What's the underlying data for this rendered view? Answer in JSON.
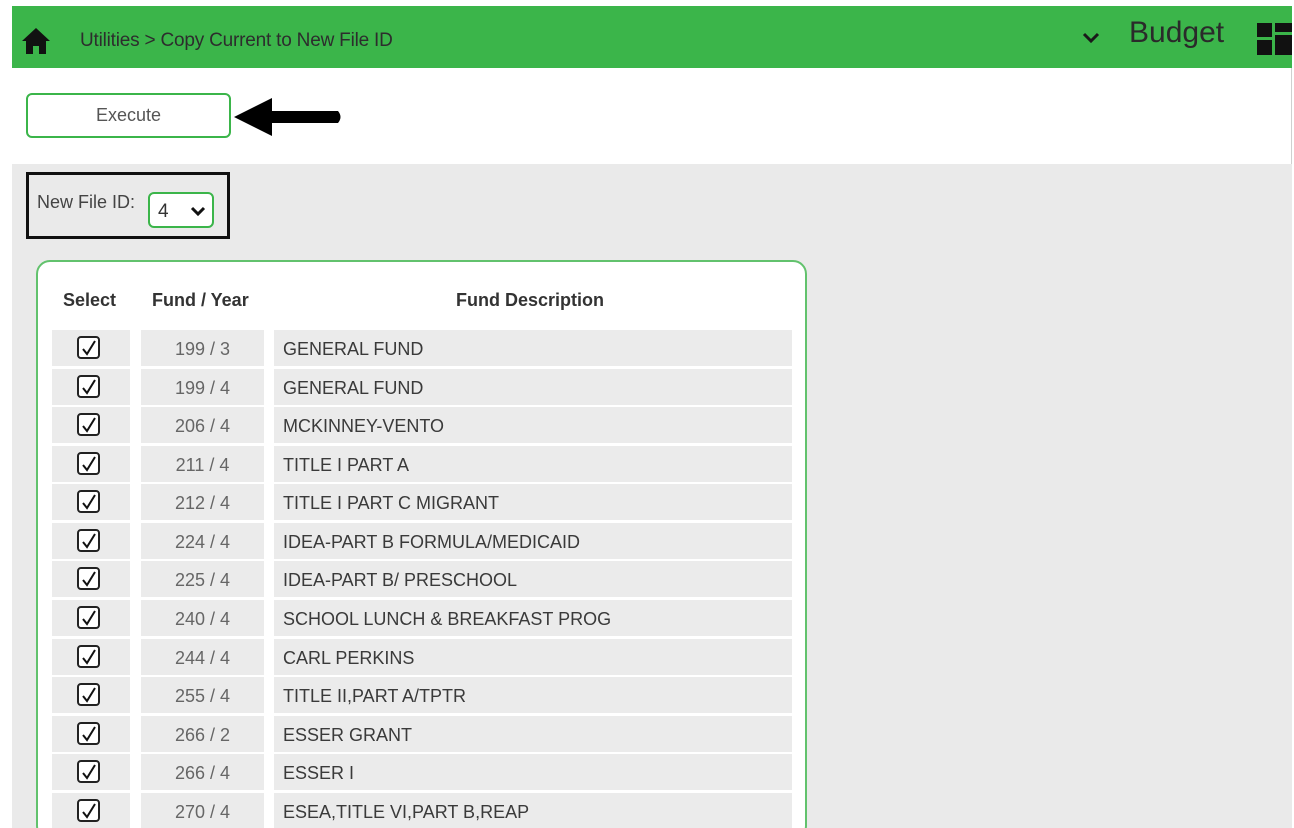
{
  "header": {
    "breadcrumb": "Utilities > Copy Current to New File ID",
    "app_title": "Budget",
    "icons": {
      "home": "home-icon",
      "menu": "chevron-down-icon",
      "layout": "grid-layout-icon"
    },
    "color": "#3bb54a"
  },
  "toolbar": {
    "execute_label": "Execute"
  },
  "file_id": {
    "label": "New File ID:",
    "value": "4"
  },
  "table": {
    "headers": {
      "select": "Select",
      "fund_year": "Fund / Year",
      "description": "Fund Description"
    },
    "rows": [
      {
        "fund_year": "199 / 3",
        "description": "GENERAL FUND",
        "selected": true
      },
      {
        "fund_year": "199 / 4",
        "description": "GENERAL FUND",
        "selected": true
      },
      {
        "fund_year": "206 / 4",
        "description": "MCKINNEY-VENTO",
        "selected": true
      },
      {
        "fund_year": "211 / 4",
        "description": "TITLE I PART A",
        "selected": true
      },
      {
        "fund_year": "212 / 4",
        "description": "TITLE I PART C MIGRANT",
        "selected": true
      },
      {
        "fund_year": "224 / 4",
        "description": "IDEA-PART B FORMULA/MEDICAID",
        "selected": true
      },
      {
        "fund_year": "225 / 4",
        "description": "IDEA-PART B/ PRESCHOOL",
        "selected": true
      },
      {
        "fund_year": "240 / 4",
        "description": "SCHOOL LUNCH & BREAKFAST PROG",
        "selected": true
      },
      {
        "fund_year": "244 / 4",
        "description": "CARL PERKINS",
        "selected": true
      },
      {
        "fund_year": "255 / 4",
        "description": "TITLE II,PART A/TPTR",
        "selected": true
      },
      {
        "fund_year": "266 / 2",
        "description": "ESSER GRANT",
        "selected": true
      },
      {
        "fund_year": "266 / 4",
        "description": "ESSER I",
        "selected": true
      },
      {
        "fund_year": "270 / 4",
        "description": "ESEA,TITLE VI,PART B,REAP",
        "selected": true
      }
    ]
  }
}
